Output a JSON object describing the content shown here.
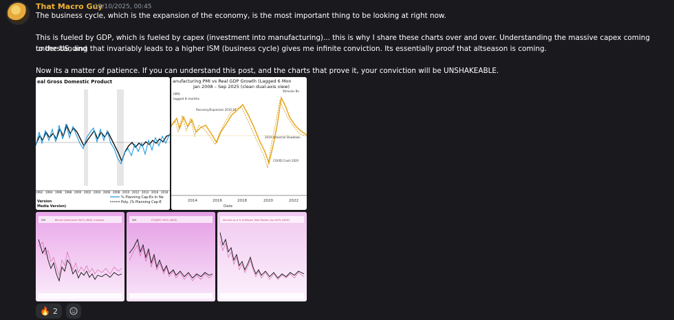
{
  "message": {
    "author": "That Macro Guy",
    "timestamp": "12/10/2025, 00:45",
    "paragraphs": [
      "The business cycle, which is the expansion of the economy, is the most important thing to be looking at right now.",
      "This is fueled by GDP, which is fueled by capex (investment into manufacturing)... this is why I share these charts over and over. Understanding the massive capex coming to the US, and",
      "understanding that invariably leads to a higher ISM (business cycle) gives me infinite conviction. Its essentially proof that altseason is coming.",
      "Now its a matter of patience. If you can understand this post, and the charts that prove it, your conviction will be UNSHAKEABLE."
    ]
  },
  "attachments": {
    "chart1": {
      "title": "eal Gross Domestic Product",
      "years": [
        "1992",
        "1994",
        "1996",
        "1998",
        "2000",
        "2002",
        "2004",
        "2006",
        "2008",
        "2010",
        "2012",
        "2014",
        "2016",
        "2018"
      ],
      "legend": [
        "% Planning Cap-Ex In Ne",
        "Poly. (% Planning Cap-E"
      ],
      "footer": [
        "Version",
        "Media Version)"
      ]
    },
    "chart2": {
      "title_line1": "anufacturing PMI vs Real GDP Growth (Lagged 6 Mon",
      "title_line2": "Jan 2008 – Sep 2025 (clean dual-axis view)",
      "side_label_1": "ISM)",
      "side_label_2": "lagged 8 months",
      "annotations": [
        "Stimulus Bo",
        "Recovery/Expansion 2010-16",
        "2019 Industrial Slowdown",
        "COVID Crash 2020"
      ],
      "x_ticks": [
        "2014",
        "2016",
        "2018",
        "2020",
        "2022"
      ],
      "xlabel": "Date"
    },
    "chart3": {
      "legend": [
        "ISM",
        "Bitcoin Dominance YoY% (INVE, Inverted"
      ]
    },
    "chart4": {
      "legend": [
        "ISM",
        "ETH/BTC YoY% (INVE)"
      ]
    },
    "chart5": {
      "legend": [
        "Altcoins as a % of Bitcoin Total Market Cap YoY% (INVE)"
      ]
    }
  },
  "reactions": [
    {
      "emoji": "🔥",
      "count": "2"
    }
  ],
  "add_reaction_icon": "smiley-add-icon"
}
